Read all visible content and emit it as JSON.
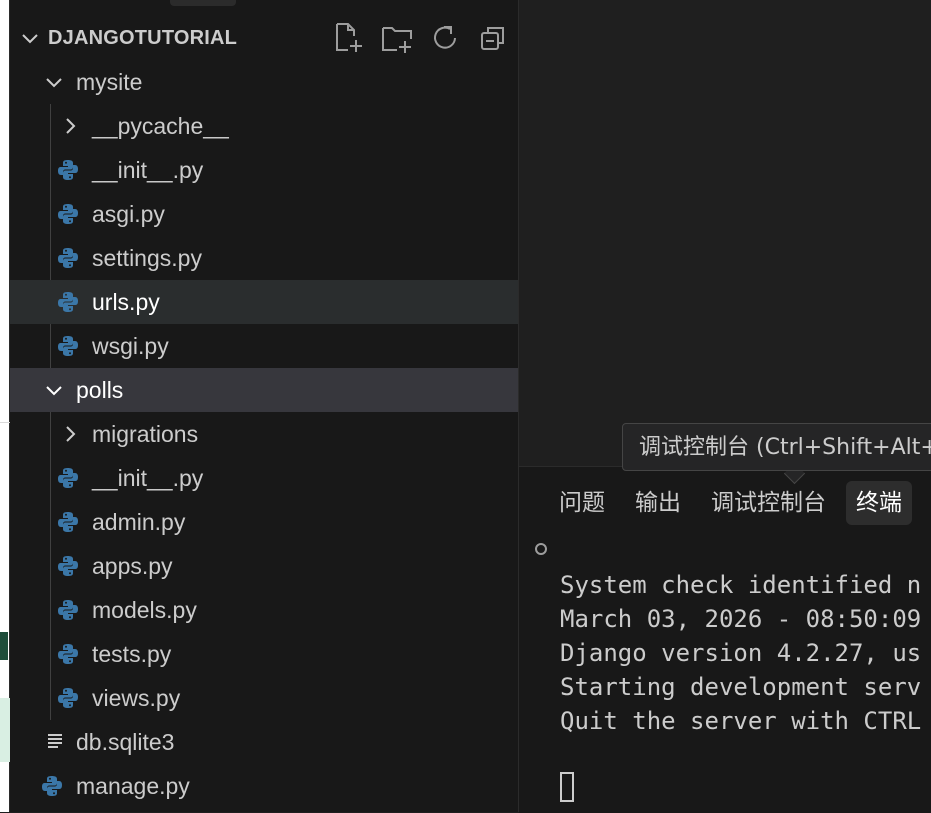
{
  "explorer": {
    "title": "DJANGOTUTORIAL",
    "actions": [
      {
        "name": "new-file-icon"
      },
      {
        "name": "new-folder-icon"
      },
      {
        "name": "refresh-icon"
      },
      {
        "name": "collapse-all-icon"
      }
    ],
    "tree": [
      {
        "label": "mysite",
        "type": "folder-open"
      },
      {
        "label": "__pycache__",
        "type": "folder-closed"
      },
      {
        "label": "__init__.py",
        "type": "python"
      },
      {
        "label": "asgi.py",
        "type": "python"
      },
      {
        "label": "settings.py",
        "type": "python"
      },
      {
        "label": "urls.py",
        "type": "python",
        "state": "selected"
      },
      {
        "label": "wsgi.py",
        "type": "python"
      },
      {
        "label": "polls",
        "type": "folder-open",
        "state": "hover"
      },
      {
        "label": "migrations",
        "type": "folder-closed"
      },
      {
        "label": "__init__.py",
        "type": "python"
      },
      {
        "label": "admin.py",
        "type": "python"
      },
      {
        "label": "apps.py",
        "type": "python"
      },
      {
        "label": "models.py",
        "type": "python"
      },
      {
        "label": "tests.py",
        "type": "python"
      },
      {
        "label": "views.py",
        "type": "python"
      },
      {
        "label": "db.sqlite3",
        "type": "text-file"
      },
      {
        "label": "manage.py",
        "type": "python"
      }
    ]
  },
  "tooltip": {
    "text": "调试控制台 (Ctrl+Shift+Alt+"
  },
  "panel": {
    "tabs": [
      {
        "label": "问题"
      },
      {
        "label": "输出"
      },
      {
        "label": "调试控制台"
      },
      {
        "label": "终端",
        "active": true
      }
    ],
    "terminal_lines": [
      "System check identified n",
      "March 03, 2026 - 08:50:09",
      "Django version 4.2.27, us",
      "Starting development serv",
      "Quit the server with CTRL"
    ]
  },
  "colors": {
    "python_blue": "#3b77a8",
    "python_yellow": "#ffd43b",
    "selected_row": "#2a2d2e",
    "hover_row": "#37373d"
  }
}
